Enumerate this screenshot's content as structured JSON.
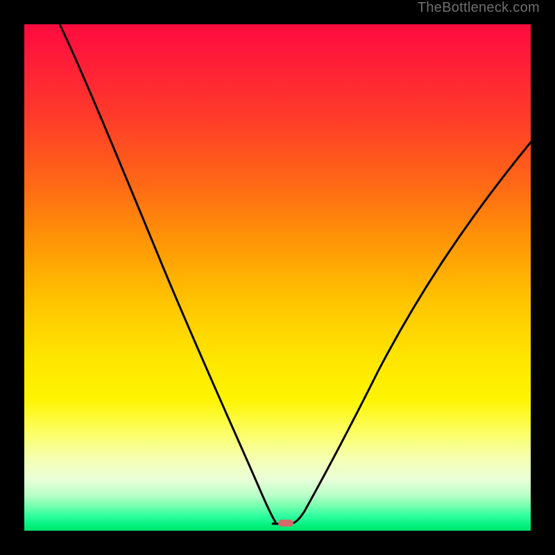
{
  "watermark": "TheBottleneck.com",
  "chart_data": {
    "type": "line",
    "title": "",
    "xlabel": "",
    "ylabel": "",
    "xlim": [
      0,
      100
    ],
    "ylim": [
      0,
      100
    ],
    "grid": false,
    "series": [
      {
        "name": "bottleneck-curve",
        "x": [
          7,
          10,
          15,
          20,
          25,
          30,
          35,
          40,
          43,
          46,
          48,
          49,
          50,
          52,
          53,
          55,
          58,
          62,
          67,
          73,
          80,
          88,
          96,
          100
        ],
        "y": [
          100,
          93,
          82,
          71,
          60,
          49,
          38,
          26,
          17,
          9,
          4,
          2,
          1.5,
          1.5,
          2,
          4,
          9,
          16,
          25,
          35,
          46,
          58,
          69,
          74
        ]
      }
    ],
    "marker": {
      "x": 51,
      "y": 1.5,
      "label": "optimal-point"
    },
    "gradient_stops": [
      {
        "pos": 0,
        "color": "#ff0b3e"
      },
      {
        "pos": 50,
        "color": "#ffe600"
      },
      {
        "pos": 90,
        "color": "#e8ffd8"
      },
      {
        "pos": 100,
        "color": "#00e06a"
      }
    ]
  }
}
